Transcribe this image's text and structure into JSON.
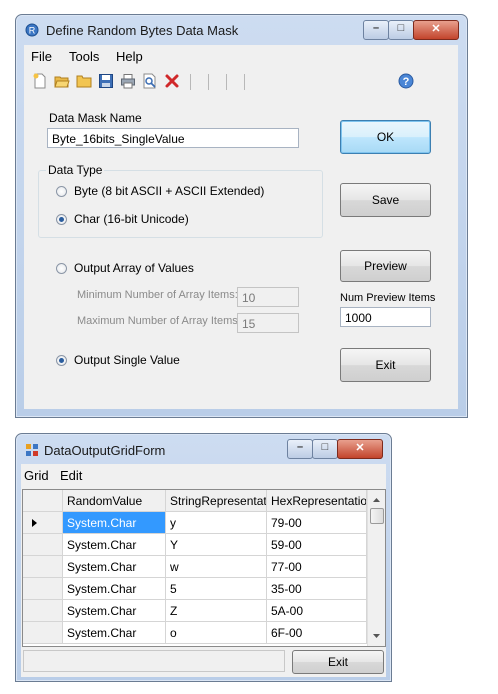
{
  "mask_window": {
    "title": "Define Random Bytes Data Mask",
    "menu": [
      "File",
      "Tools",
      "Help"
    ],
    "toolbar_icons": [
      "new-icon",
      "open-folder-icon",
      "folder-icon",
      "save-icon",
      "print-icon",
      "print-preview-icon",
      "delete-icon",
      "help-icon"
    ],
    "mask_name_label": "Data Mask Name",
    "mask_name_value": "Byte_16bits_SingleValue",
    "data_type_label": "Data Type",
    "radio_byte_label": "Byte (8 bit ASCII + ASCII Extended)",
    "radio_char_label": "Char (16-bit Unicode)",
    "radio_array_label": "Output Array of Values",
    "min_items_label": "Minimum Number of Array Items:",
    "min_items_value": "10",
    "max_items_label": "Maximum Number of Array Items:",
    "max_items_value": "15",
    "radio_single_label": "Output Single Value",
    "ok_label": "OK",
    "save_label": "Save",
    "preview_label": "Preview",
    "num_preview_label": "Num Preview Items",
    "num_preview_value": "1000",
    "exit_label": "Exit",
    "selected_data_type": "Char",
    "selected_output": "Single"
  },
  "grid_window": {
    "title": "DataOutputGridForm",
    "menu": [
      "Grid",
      "Edit"
    ],
    "columns": [
      "RandomValue",
      "StringRepresentatic",
      "HexRepresentation"
    ],
    "rows": [
      [
        "System.Char",
        "y",
        "79-00"
      ],
      [
        "System.Char",
        "Y",
        "59-00"
      ],
      [
        "System.Char",
        "w",
        "77-00"
      ],
      [
        "System.Char",
        "5",
        "35-00"
      ],
      [
        "System.Char",
        "Z",
        "5A-00"
      ],
      [
        "System.Char",
        "o",
        "6F-00"
      ]
    ],
    "exit_label": "Exit"
  },
  "colors": {
    "selection": "#3399ff",
    "title_bar": "#c6d7ee",
    "close_button": "#c3442c"
  }
}
